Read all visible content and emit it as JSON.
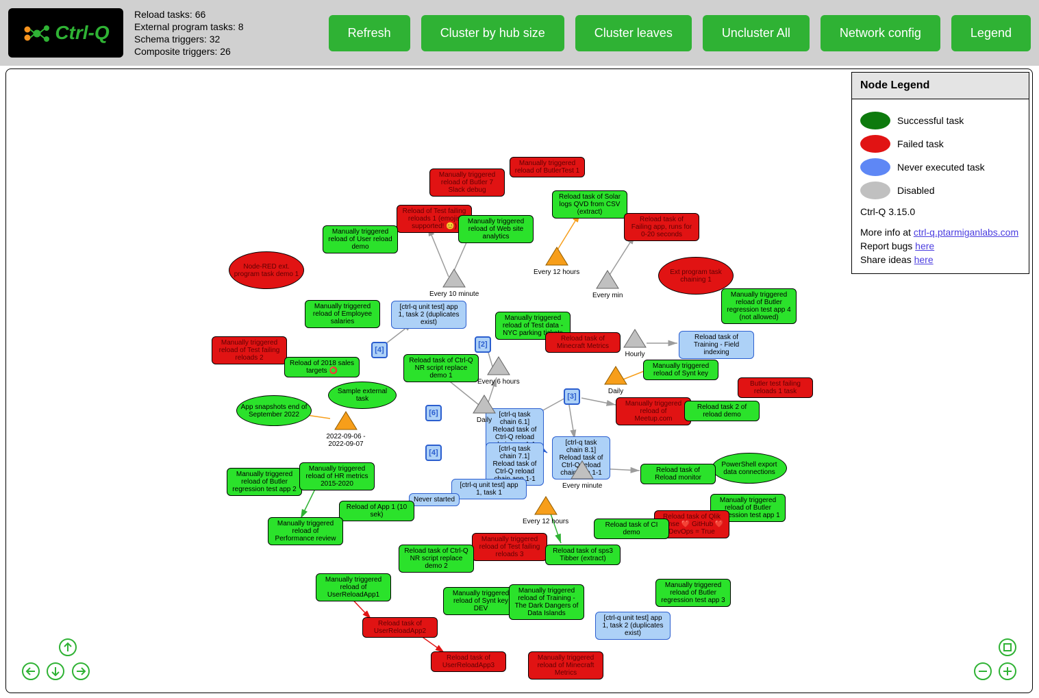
{
  "brand": "Ctrl-Q",
  "stats": {
    "reload_tasks": "Reload tasks: 66",
    "ext_prog_tasks": "External program tasks: 8",
    "schema_triggers": "Schema triggers: 32",
    "composite_triggers": "Composite triggers: 26"
  },
  "buttons": {
    "refresh": "Refresh",
    "cluster_hub": "Cluster by hub size",
    "cluster_leaves": "Cluster leaves",
    "uncluster": "Uncluster All",
    "network_config": "Network config",
    "legend": "Legend"
  },
  "legend": {
    "title": "Node Legend",
    "successful": "Successful task",
    "failed": "Failed task",
    "never": "Never executed task",
    "disabled": "Disabled",
    "version": "Ctrl-Q 3.15.0",
    "more_info": "More info at ",
    "more_info_link": "ctrl-q.ptarmiganlabs.com",
    "report_bugs": "Report bugs ",
    "report_bugs_link": "here",
    "share_ideas": "Share ideas ",
    "share_ideas_link": "here"
  },
  "nodes": {
    "n1": "Manually triggered reload of ButlerTest 1",
    "n2": "Manually triggered reload of Butler 7 Slack debug",
    "n3": "Reload of Test failing reloads 1 (emojis supported! 😊)",
    "n4": "Manually triggered reload of User reload demo",
    "n5": "Manually triggered reload of Web site analytics",
    "n6": "Reload task of Solar logs QVD from CSV (extract)",
    "n7": "Reload task of Failing app, runs for 0-20 seconds",
    "n8": "Node-RED ext. program task demo 1",
    "n9": "Ext program task chaining 1",
    "n10": "Manually triggered reload of Butler regression test app 4 (not allowed)",
    "n11": "Manually triggered reload of Employee salaries",
    "n12": "[ctrl-q unit test] app 1, task 2 (duplicates exist)",
    "n13": "Manually triggered reload of Test data - NYC parking tickets",
    "n14": "Reload task of Training - Field indexing",
    "n15": "Manually triggered reload of Test failing reloads 2",
    "n16": "Reload of 2018 sales targets ⭕",
    "n17": "Reload task of Minecraft Metrics",
    "n18": "Reload task of Ctrl-Q NR script replace demo 1",
    "n19": "Sample external task",
    "n20": "Manually triggered reload of Synt key",
    "n21": "Butler test failing reloads 1 task",
    "n22": "App snapshots end of September 2022",
    "n23": "Manually triggered reload of Meetup.com",
    "n24": "Reload task 2 of reload demo",
    "n25": "[ctrl-q task chain 6.1] Reload task of Ctrl-Q reload chain app 1-1",
    "n26": "[ctrl-q task chain 7.1] Reload task of Ctrl-Q reload chain app 1-1",
    "n27": "[ctrl-q task chain 8.1] Reload task of Ctrl-Q reload chain app 1-1",
    "n28": "PowerShell export data connections",
    "n29": "Manually triggered reload of Butler regression test app 2",
    "n30": "Manually triggered reload of HR metrics 2015-2020",
    "n31": "Reload task of Reload monitor",
    "n32": "[ctrl-q unit test] app 1, task 1",
    "n33": "Never started",
    "n34": "Reload of App 1 (10 sek)",
    "n35": "Manually triggered reload of Performance review",
    "n36": "Manually triggered reload of Butler regression test app 1",
    "n37": "Reload task of Qlik Sense ❤️ GitHub ❤️ DevOps = True",
    "n38": "Reload task of CI demo",
    "n39": "Manually triggered reload of Test failing reloads 3",
    "n40": "Reload task of sps3 Tibber (extract)",
    "n41": "Reload task of Ctrl-Q NR script replace demo 2",
    "n42": "Manually triggered reload of UserReloadApp1",
    "n43": "Manually triggered reload of Synt key DEV",
    "n44": "Manually triggered reload of Butler regression test app 3",
    "n45": "Manually triggered reload of Training - The Dark Dangers of Data Islands",
    "n46": "Reload task of UserReloadApp2",
    "n47": "[ctrl-q unit test] app 1, task 2 (duplicates exist)",
    "n48": "Reload task of UserReloadApp3",
    "n49": "Manually triggered reload of Minecraft Metrics"
  },
  "triangles": {
    "t1": "Every 12 hours",
    "t2": "Every 10 minute",
    "t3": "Every min",
    "t4": "Hourly",
    "t5": "Every 6 hours",
    "t6": "Daily",
    "t7": "Daily",
    "t8": "2022-09-06 - 2022-09-07",
    "t9": "Every minute",
    "t10": "Every 12 hours"
  },
  "clusters": {
    "c1": "[4]",
    "c2": "[2]",
    "c3": "[3]",
    "c4": "[6]",
    "c5": "[4]"
  }
}
